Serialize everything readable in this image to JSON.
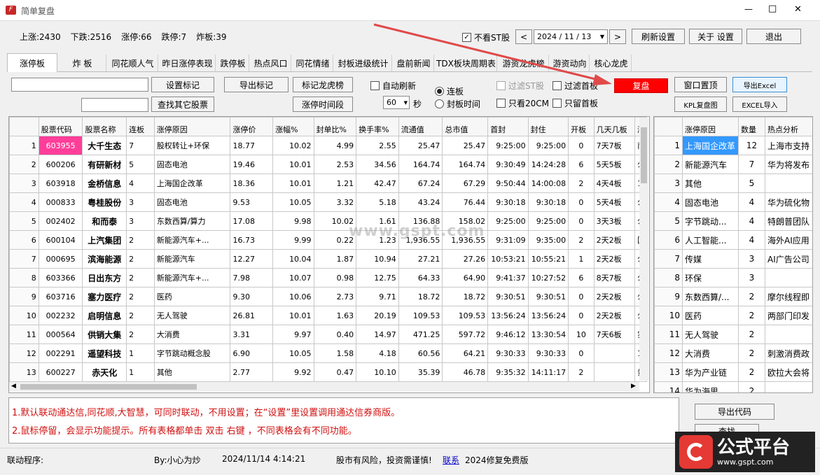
{
  "window": {
    "title": "简单复盘",
    "controls": [
      "—",
      "□",
      "✕"
    ]
  },
  "stats": {
    "up": "上涨:2430",
    "down": "下跌:2516",
    "limit_up": "涨停:66",
    "limit_down": "跌停:7",
    "broken": "炸板:39"
  },
  "topbar": {
    "st_label": "不看ST股",
    "date": "2024 / 11 / 13",
    "refresh": "刷新设置",
    "about": "关于 设置",
    "exit": "退出"
  },
  "tabs": [
    "涨停板",
    "炸 板",
    "同花顺人气",
    "昨日涨停表现",
    "跌停板",
    "热点风口",
    "同花情绪",
    "封板进级统计",
    "盘前新闻",
    "TDX板块周期表",
    "游资龙虎榜",
    "游资动向",
    "核心龙虎"
  ],
  "toolbar": {
    "set_mark": "设置标记",
    "export_mark": "导出标记",
    "mark_dragon": "标记龙虎榜",
    "find_other": "查找其它股票",
    "limit_time": "涨停时间段",
    "auto_refresh": "自动刷新",
    "interval": "60",
    "sec": "秒",
    "radio_board": "连板",
    "radio_time": "封板时间",
    "filter_st": "过滤ST股",
    "filter_first": "过滤首板",
    "only20": "只看20CM",
    "only_first": "只留首板",
    "review": "复盘",
    "pin_window": "窗口置顶",
    "export_excel": "导出Excel",
    "kpl": "KPL复盘图",
    "excel_import": "EXCEL导入"
  },
  "main_table": {
    "columns": [
      "股票代码",
      "股票名称",
      "连板",
      "涨停原因",
      "涨停价",
      "涨幅%",
      "封单比%",
      "换手率%",
      "流通值",
      "总市值",
      "首封",
      "封住",
      "开板",
      "几天几板",
      "涨"
    ],
    "rows": [
      [
        "1",
        "603955",
        "大千生态",
        "7",
        "股权转让+环保",
        "18.77",
        "10.02",
        "4.99",
        "2.55",
        "25.47",
        "25.47",
        "9:25:00",
        "9:25:00",
        "0",
        "7天7板",
        "南"
      ],
      [
        "2",
        "600206",
        "有研新材",
        "5",
        "固态电池",
        "19.46",
        "10.01",
        "2.53",
        "34.56",
        "164.74",
        "164.74",
        "9:30:49",
        "14:24:28",
        "6",
        "5天5板",
        "公"
      ],
      [
        "3",
        "603918",
        "金桥信息",
        "4",
        "上海国企改革",
        "18.36",
        "10.01",
        "1.21",
        "42.47",
        "67.24",
        "67.29",
        "9:50:44",
        "14:00:08",
        "2",
        "4天4板",
        "1、"
      ],
      [
        "4",
        "000833",
        "粤桂股份",
        "3",
        "固态电池",
        "9.53",
        "10.05",
        "3.32",
        "5.18",
        "43.24",
        "76.44",
        "9:30:18",
        "9:30:18",
        "0",
        "5天4板",
        "公"
      ],
      [
        "5",
        "002402",
        "和而泰",
        "3",
        "东数西算/算力",
        "17.08",
        "9.98",
        "10.02",
        "1.61",
        "136.88",
        "158.02",
        "9:25:00",
        "9:25:00",
        "0",
        "3天3板",
        "公"
      ],
      [
        "6",
        "600104",
        "上汽集团",
        "2",
        "新能源汽车+...",
        "16.73",
        "9.99",
        "0.22",
        "1.23",
        "1,936.55",
        "1,936.55",
        "9:31:09",
        "9:35:00",
        "2",
        "2天2板",
        "国"
      ],
      [
        "7",
        "000695",
        "滨海能源",
        "2",
        "新能源汽车",
        "12.27",
        "10.04",
        "1.87",
        "10.94",
        "27.21",
        "27.26",
        "10:53:21",
        "10:55:21",
        "1",
        "2天2板",
        "公"
      ],
      [
        "8",
        "603366",
        "日出东方",
        "2",
        "新能源汽车+...",
        "7.98",
        "10.07",
        "0.98",
        "12.75",
        "64.33",
        "64.90",
        "9:41:37",
        "10:27:52",
        "6",
        "8天7板",
        "公"
      ],
      [
        "9",
        "603716",
        "塞力医疗",
        "2",
        "医药",
        "9.30",
        "10.06",
        "2.73",
        "9.71",
        "18.72",
        "18.72",
        "9:30:51",
        "9:30:51",
        "0",
        "2天2板",
        "公"
      ],
      [
        "10",
        "002232",
        "启明信息",
        "2",
        "无人驾驶",
        "26.81",
        "10.01",
        "1.63",
        "20.19",
        "109.53",
        "109.53",
        "13:56:24",
        "13:56:24",
        "0",
        "2天2板",
        "公"
      ],
      [
        "11",
        "000564",
        "供销大集",
        "2",
        "大消费",
        "3.31",
        "9.97",
        "0.40",
        "14.97",
        "471.25",
        "597.72",
        "9:46:12",
        "13:30:54",
        "10",
        "7天6板",
        "实"
      ],
      [
        "12",
        "002291",
        "遥望科技",
        "1",
        "字节跳动概念股",
        "6.90",
        "10.05",
        "1.58",
        "4.18",
        "60.56",
        "64.21",
        "9:30:33",
        "9:30:33",
        "0",
        "",
        "1、"
      ],
      [
        "13",
        "600227",
        "赤天化",
        "1",
        "其他",
        "2.77",
        "9.92",
        "0.47",
        "10.10",
        "35.39",
        "46.78",
        "9:35:32",
        "14:11:17",
        "2",
        "",
        "贵"
      ]
    ]
  },
  "side_table": {
    "columns": [
      "涨停原因",
      "数量",
      "热点分析"
    ],
    "rows": [
      [
        "1",
        "上海国企改革",
        "12",
        "上海市支持"
      ],
      [
        "2",
        "新能源汽车",
        "7",
        "华为将发布"
      ],
      [
        "3",
        "其他",
        "5",
        ""
      ],
      [
        "4",
        "固态电池",
        "4",
        "华为硫化物"
      ],
      [
        "5",
        "字节跳动...",
        "4",
        "特朗普团队"
      ],
      [
        "6",
        "人工智能...",
        "4",
        "海外AI应用"
      ],
      [
        "7",
        "传媒",
        "3",
        "AI广告公司"
      ],
      [
        "8",
        "环保",
        "3",
        ""
      ],
      [
        "9",
        "东数西算/...",
        "2",
        "摩尔线程即"
      ],
      [
        "10",
        "医药",
        "2",
        "两部门印发"
      ],
      [
        "11",
        "无人驾驶",
        "2",
        ""
      ],
      [
        "12",
        "大消费",
        "2",
        "刺激消费政"
      ],
      [
        "13",
        "华为产业链",
        "2",
        "欧拉大会将"
      ],
      [
        "14",
        "华为海思",
        "2",
        ""
      ]
    ]
  },
  "notes": [
    "1.默认联动通达信,同花顺,大智慧，可同时联动，不用设置；在“设置”里设置调用通达信券商版。",
    "2.鼠标停留，会显示功能提示。所有表格都单击 双击 右键 ，不同表格会有不同功能。"
  ],
  "export_code": "导出代码",
  "find_btn": "查找",
  "status": {
    "link": "联动程序:",
    "author": "By:小心为炒",
    "time": "2024/11/14 4:14:21",
    "risk": "股市有风险，投资需谨慎!",
    "contact": "联系",
    "version": "2024修复免费版"
  },
  "watermark": {
    "logo_text": "公式平台",
    "url": "www.gspt.com",
    "center": "www.gspt.com"
  },
  "colors": {
    "review_red": "#ff0000",
    "highlight_pink": "#ff3e9a",
    "selected_blue": "#3399ff",
    "arrow": "#e04a4a",
    "link_blue": "#0000cc"
  }
}
